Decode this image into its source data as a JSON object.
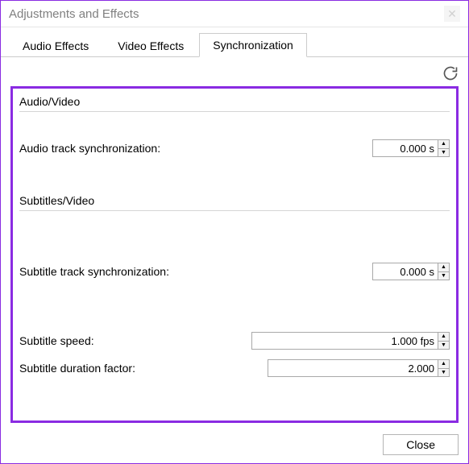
{
  "window": {
    "title": "Adjustments and Effects"
  },
  "tabs": {
    "audio_effects": "Audio Effects",
    "video_effects": "Video Effects",
    "synchronization": "Synchronization"
  },
  "groups": {
    "audio_video": "Audio/Video",
    "subtitles_video": "Subtitles/Video"
  },
  "fields": {
    "audio_track_sync": {
      "label": "Audio track synchronization:",
      "value": "0.000 s"
    },
    "subtitle_track_sync": {
      "label": "Subtitle track synchronization:",
      "value": "0.000 s"
    },
    "subtitle_speed": {
      "label": "Subtitle speed:",
      "value": "1.000 fps"
    },
    "subtitle_duration_factor": {
      "label": "Subtitle duration factor:",
      "value": "2.000"
    }
  },
  "buttons": {
    "close": "Close"
  }
}
